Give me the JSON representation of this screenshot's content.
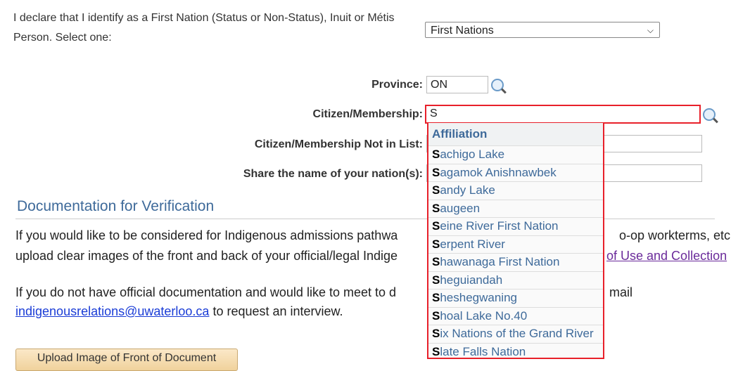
{
  "declaration": {
    "label": "I declare that I identify as a First Nation (Status or Non-Status), Inuit or Métis Person. Select one:",
    "selected": "First Nations"
  },
  "province": {
    "label": "Province:",
    "value": "ON"
  },
  "citizen": {
    "label": "Citizen/Membership:",
    "value": "S"
  },
  "not_in_list": {
    "label": "Citizen/Membership Not in List:",
    "value": ""
  },
  "nation_name": {
    "label": "Share the name of your nation(s):",
    "value": ""
  },
  "dropdown": {
    "header": "Affiliation",
    "typed": "S",
    "items": [
      "achigo Lake",
      "agamok Anishnawbek",
      "andy Lake",
      "augeen",
      "eine River First Nation",
      "erpent River",
      "hawanaga First Nation",
      "heguiandah",
      "heshegwaning",
      "hoal Lake No.40",
      "ix Nations of the Grand River",
      "late Falls Nation"
    ]
  },
  "section": {
    "title": "Documentation for Verification",
    "p1a": "If you would like to be considered for Indigenous admissions pathwa",
    "p1b": "o-op workterms, etc.",
    "p2a": "upload clear images of the front and back of your official/legal Indige",
    "p2link": "of Use and Collection",
    "p3a": "If you do not have official documentation and would like to meet to d",
    "p3b": "mail",
    "email": "indigenousrelations@uwaterloo.ca",
    "p4": " to request an interview.",
    "upload_button": "Upload Image of Front of Document"
  },
  "colors": {
    "highlight": "#e8202a",
    "heading": "#3e6a9a"
  }
}
